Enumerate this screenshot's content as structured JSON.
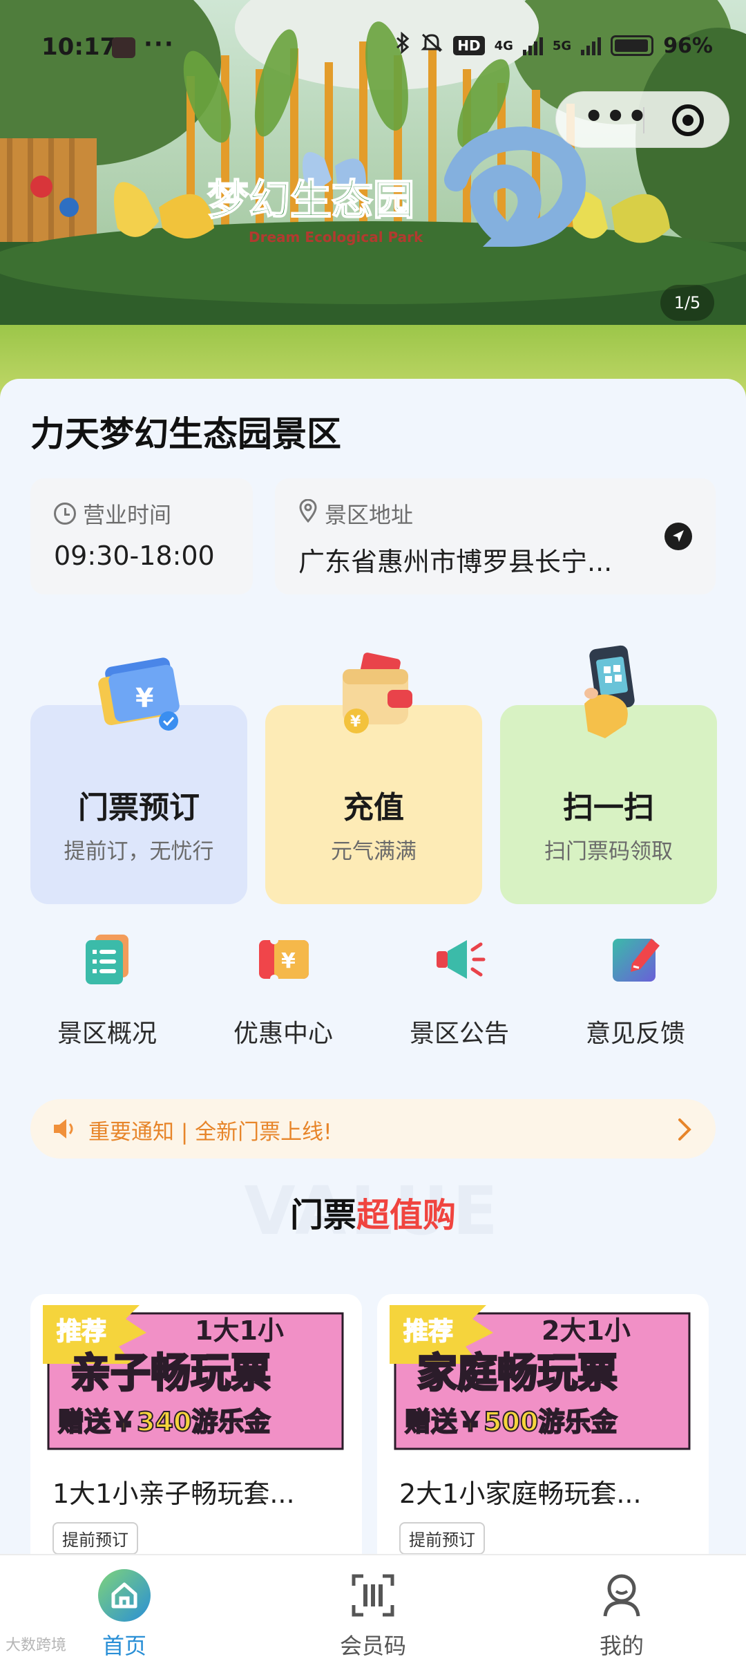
{
  "status_bar": {
    "time": "10:17",
    "dots": "···",
    "hd_label": "HD",
    "net_4g": "4G",
    "net_5g": "5G",
    "battery": "96%"
  },
  "banner": {
    "pager": "1/5",
    "sign_text": "梦幻生态园",
    "sign_subtext": "Dream Ecological Park"
  },
  "scenic": {
    "name": "力天梦幻生态园景区",
    "hours_label": "营业时间",
    "hours_value": "09:30-18:00",
    "address_label": "景区地址",
    "address_value": "广东省惠州市博罗县长宁..."
  },
  "features": [
    {
      "title": "门票预订",
      "subtitle": "提前订，无忧行",
      "icon": "ticket-icon"
    },
    {
      "title": "充值",
      "subtitle": "元气满满",
      "icon": "wallet-icon"
    },
    {
      "title": "扫一扫",
      "subtitle": "扫门票码领取",
      "icon": "phone-scan-icon"
    }
  ],
  "shortcuts": [
    {
      "label": "景区概况",
      "icon": "list-icon"
    },
    {
      "label": "优惠中心",
      "icon": "coupon-icon"
    },
    {
      "label": "景区公告",
      "icon": "megaphone-icon"
    },
    {
      "label": "意见反馈",
      "icon": "edit-icon"
    }
  ],
  "notice": {
    "text": "重要通知 | 全新门票上线!"
  },
  "section": {
    "bg_word": "VALUE",
    "title_part1": "门票",
    "title_part2": "超值购"
  },
  "products": [
    {
      "poster_badge": "推荐",
      "poster_top": "1大1小",
      "poster_main": "亲子畅玩票",
      "poster_bottom": "赠送￥340游乐金",
      "title": "1大1小亲子畅玩套...",
      "tag": "提前预订"
    },
    {
      "poster_badge": "推荐",
      "poster_top": "2大1小",
      "poster_main": "家庭畅玩票",
      "poster_bottom": "赠送￥500游乐金",
      "title": "2大1小家庭畅玩套...",
      "tag": "提前预订"
    }
  ],
  "tabbar": [
    {
      "label": "首页",
      "icon": "home-icon",
      "active": true
    },
    {
      "label": "会员码",
      "icon": "scan-code-icon",
      "active": false
    },
    {
      "label": "我的",
      "icon": "profile-icon",
      "active": false
    }
  ],
  "watermark": "大数跨境",
  "colors": {
    "accent_blue": "#2a8fd6",
    "notice_orange": "#e7852a",
    "highlight_red": "#f0443f",
    "poster_pink": "#f190c6"
  }
}
